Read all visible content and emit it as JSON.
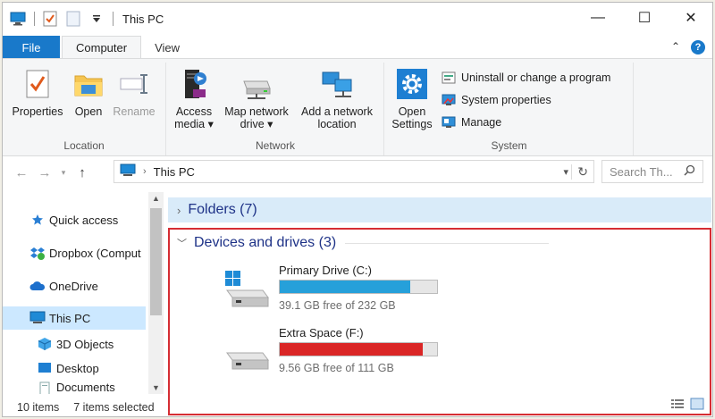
{
  "window": {
    "title": "This PC",
    "controls": {
      "minimize": "—",
      "maximize": "☐",
      "close": "✕"
    }
  },
  "tabs": [
    {
      "label": "File"
    },
    {
      "label": "Computer"
    },
    {
      "label": "View"
    }
  ],
  "ribbon": {
    "location": {
      "label": "Location",
      "buttons": [
        {
          "label": "Properties",
          "icon": "properties-checklist-icon"
        },
        {
          "label": "Open",
          "icon": "folder-icon"
        },
        {
          "label": "Rename",
          "icon": "rename-icon"
        }
      ]
    },
    "network": {
      "label": "Network",
      "buttons": [
        {
          "line1": "Access",
          "line2": "media ▾",
          "icon": "media-server-icon"
        },
        {
          "line1": "Map network",
          "line2": "drive ▾",
          "icon": "network-drive-icon"
        },
        {
          "line1": "Add a network",
          "line2": "location",
          "icon": "network-location-icon"
        }
      ]
    },
    "system": {
      "label": "System",
      "open_settings": {
        "line1": "Open",
        "line2": "Settings",
        "icon": "gear-icon"
      },
      "items": [
        {
          "label": "Uninstall or change a program",
          "icon": "uninstall-icon"
        },
        {
          "label": "System properties",
          "icon": "system-properties-icon"
        },
        {
          "label": "Manage",
          "icon": "manage-icon"
        }
      ]
    }
  },
  "address": {
    "path": "This PC",
    "search_placeholder": "Search Th..."
  },
  "nav": [
    {
      "label": "Quick access",
      "icon": "star-icon"
    },
    {
      "label": "Dropbox (Comput",
      "icon": "dropbox-icon"
    },
    {
      "label": "OneDrive",
      "icon": "cloud-icon"
    },
    {
      "label": "This PC",
      "icon": "computer-icon",
      "selected": true
    },
    {
      "label": "3D Objects",
      "icon": "cube-icon"
    },
    {
      "label": "Desktop",
      "icon": "desktop-icon"
    },
    {
      "label": "Documents",
      "icon": "documents-icon"
    }
  ],
  "content": {
    "folders_header": "Folders (7)",
    "devices_header": "Devices and drives (3)",
    "drives": [
      {
        "name": "Primary Drive (C:)",
        "info": "39.1 GB free of 232 GB",
        "used_fraction": 0.83,
        "bar_color": "#26a0da",
        "has_windows_logo": true
      },
      {
        "name": "Extra Space (F:)",
        "info": "9.56 GB free of 111 GB",
        "used_fraction": 0.91,
        "bar_color": "#da2626",
        "has_windows_logo": false
      }
    ]
  },
  "status": {
    "items": "10 items",
    "selected": "7 items selected"
  }
}
